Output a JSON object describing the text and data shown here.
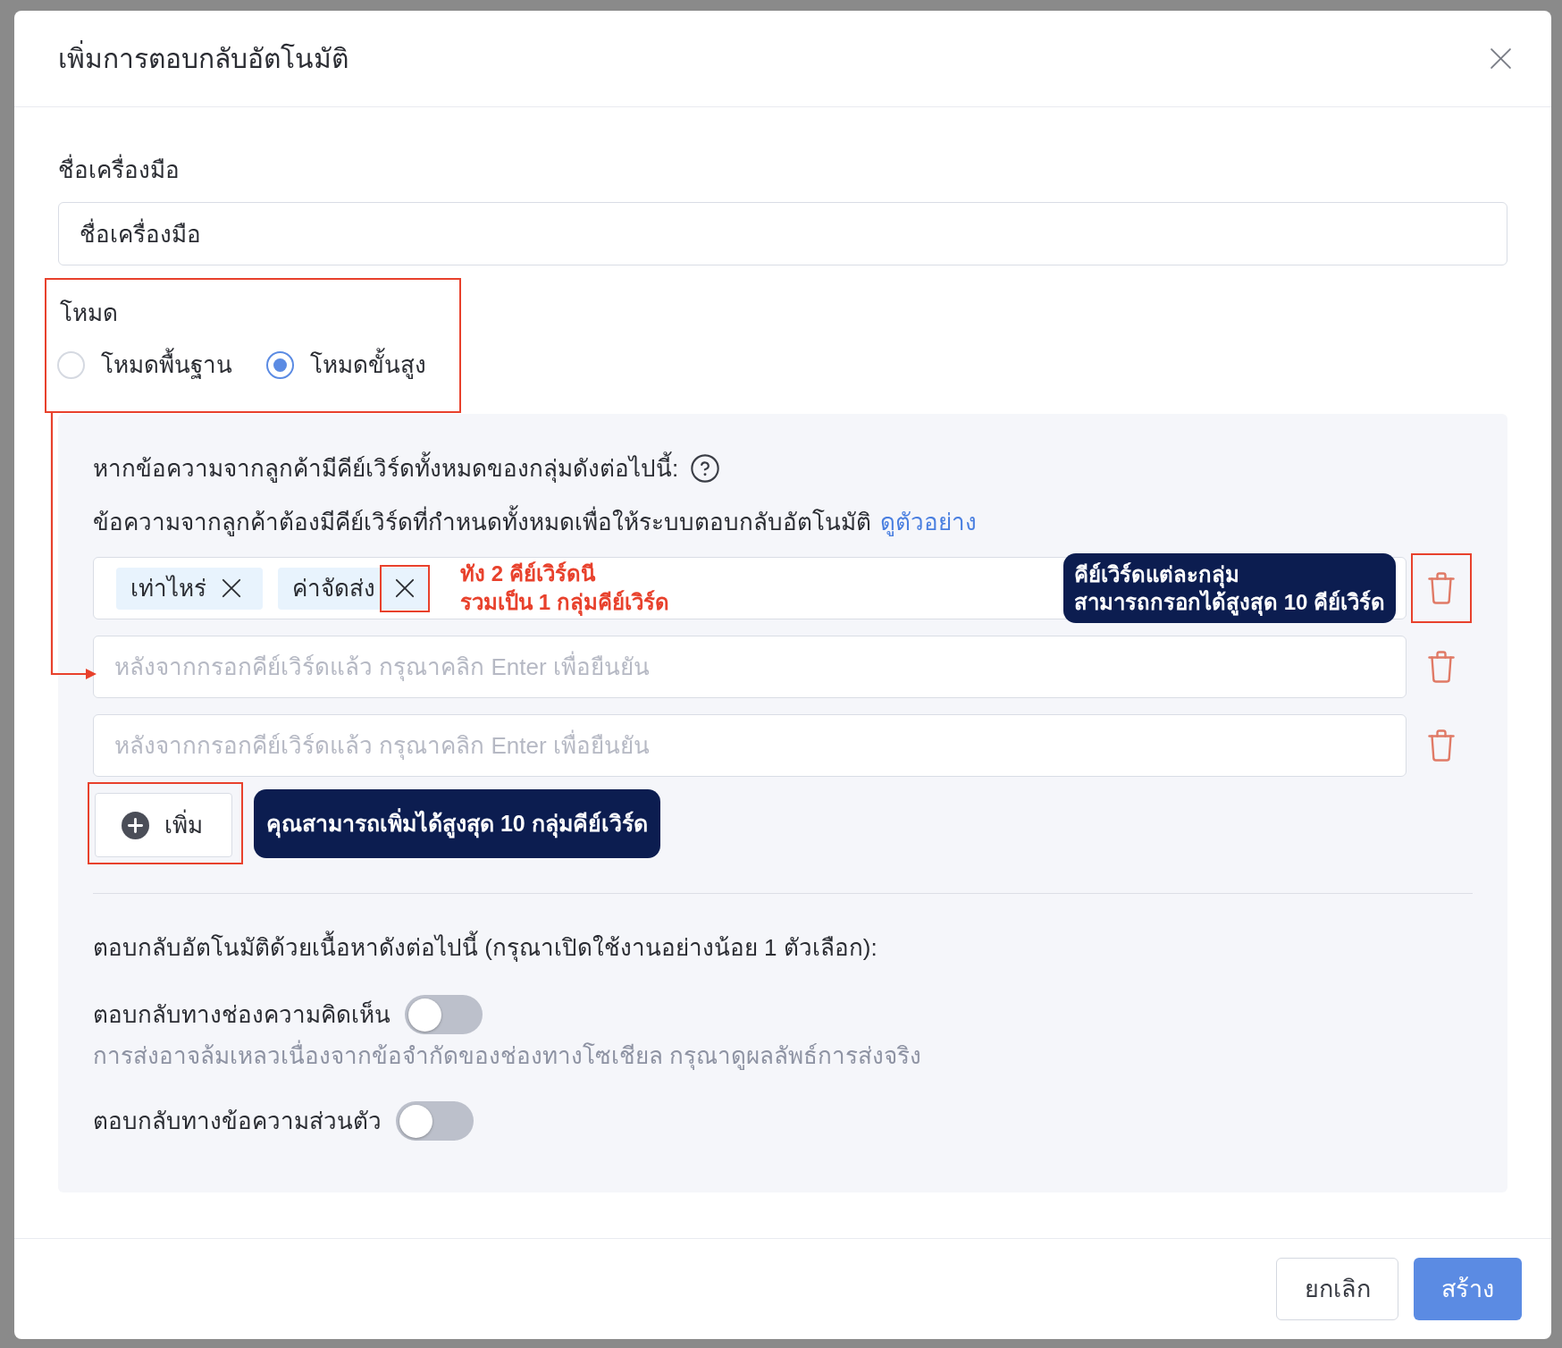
{
  "dialog": {
    "title": "เพิ่มการตอบกลับอัตโนมัติ"
  },
  "tool_name": {
    "label": "ชื่อเครื่องมือ",
    "value": "ชื่อเครื่องมือ"
  },
  "mode": {
    "label": "โหมด",
    "highlighted": true,
    "options": [
      {
        "label": "โหมดพื้นฐาน",
        "selected": false
      },
      {
        "label": "โหมดขั้นสูง",
        "selected": true
      }
    ]
  },
  "keywords": {
    "heading": "หากข้อความจากลูกค้ามีคีย์เวิร์ดทั้งหมดของกลุ่มดังต่อไปนี้:",
    "description": "ข้อความจากลูกค้าต้องมีคีย์เวิร์ดที่กำหนดทั้งหมดเพื่อให้ระบบตอบกลับอัตโนมัติ",
    "example_link": "ดูตัวอย่าง",
    "groups": [
      {
        "tags": [
          {
            "label": "เท่าไหร่",
            "highlighted": false
          },
          {
            "label": "ค่าจัดส่ง",
            "highlighted": true
          }
        ],
        "note": [
          "ทัง 2 คีย์เวิร์ดนี",
          "รวมเป็น 1 กลุ่มคีย์เวิร์ด"
        ],
        "callout": [
          "คีย์เวิร์ดแต่ละกลุ่ม",
          "สามารถกรอกได้สูงสุด 10 คีย์เวิร์ด"
        ],
        "delete_highlighted": true
      },
      {
        "placeholder": "หลังจากกรอกคีย์เวิร์ดแล้ว กรุณาคลิก Enter เพื่อยืนยัน",
        "delete_highlighted": false
      },
      {
        "placeholder": "หลังจากกรอกคีย์เวิร์ดแล้ว กรุณาคลิก Enter เพื่อยืนยัน",
        "delete_highlighted": false
      }
    ],
    "add_button": {
      "label": "เพิ่ม",
      "highlighted": true
    },
    "add_callout": "คุณสามารถเพิ่มได้สูงสุด 10 กลุ่มคีย์เวิร์ด"
  },
  "reply_content": {
    "heading": "ตอบกลับอัตโนมัติด้วยเนื้อหาดังต่อไปนี้ (กรุณาเปิดใช้งานอย่างน้อย 1 ตัวเลือก):",
    "options": [
      {
        "label": "ตอบกลับทางช่องความคิดเห็น",
        "on": false,
        "hint": "การส่งอาจล้มเหลวเนื่องจากข้อจำกัดของช่องทางโซเชียล กรุณาดูผลลัพธ์การส่งจริง"
      },
      {
        "label": "ตอบกลับทางข้อความส่วนตัว",
        "on": false
      }
    ]
  },
  "footer": {
    "buttons": [
      {
        "label": "ยกเลิก",
        "kind": "secondary"
      },
      {
        "label": "สร้าง",
        "kind": "primary"
      }
    ]
  }
}
